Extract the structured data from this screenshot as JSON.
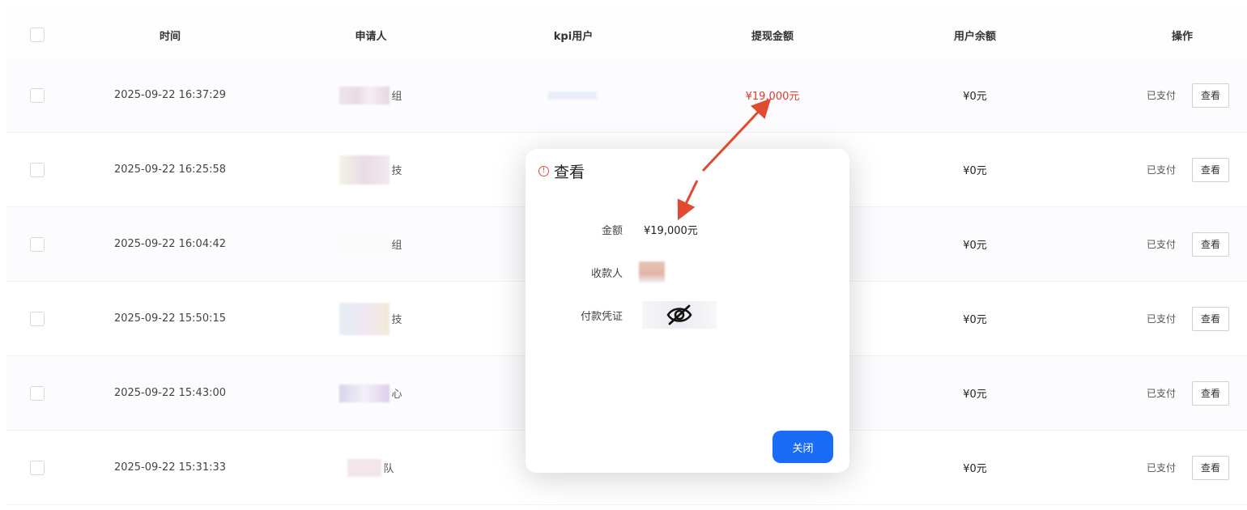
{
  "table": {
    "headers": {
      "time": "时间",
      "applicant": "申请人",
      "kpi_user": "kpi用户",
      "amount": "提现金额",
      "balance": "用户余额",
      "actions": "操作"
    },
    "rows": [
      {
        "time": "2025-09-22 16:37:29",
        "applicant_suffix": "组",
        "amount": "¥19,000元",
        "balance": "¥0元",
        "status": "已支付",
        "view": "查看"
      },
      {
        "time": "2025-09-22 16:25:58",
        "applicant_suffix": "技",
        "amount": "",
        "balance": "¥0元",
        "status": "已支付",
        "view": "查看"
      },
      {
        "time": "2025-09-22 16:04:42",
        "applicant_suffix": "组",
        "amount": "",
        "balance": "¥0元",
        "status": "已支付",
        "view": "查看"
      },
      {
        "time": "2025-09-22 15:50:15",
        "applicant_suffix": "技",
        "amount": "",
        "balance": "¥0元",
        "status": "已支付",
        "view": "查看"
      },
      {
        "time": "2025-09-22 15:43:00",
        "applicant_suffix": "心",
        "amount": "",
        "balance": "¥0元",
        "status": "已支付",
        "view": "查看"
      },
      {
        "time": "2025-09-22 15:31:33",
        "applicant_suffix": "队",
        "amount": "",
        "balance": "¥0元",
        "status": "已支付",
        "view": "查看"
      }
    ]
  },
  "modal": {
    "title": "查看",
    "amount_label": "金额",
    "amount_value": "¥19,000元",
    "payee_label": "收款人",
    "voucher_label": "付款凭证",
    "close_label": "关闭"
  },
  "colors": {
    "accent": "#1a6cf6",
    "amount_red": "#e03a2a",
    "annotation_arrow": "#e04a30"
  },
  "icons": {
    "title_icon": "info-circle-icon",
    "voucher_icon": "eye-off-icon"
  }
}
